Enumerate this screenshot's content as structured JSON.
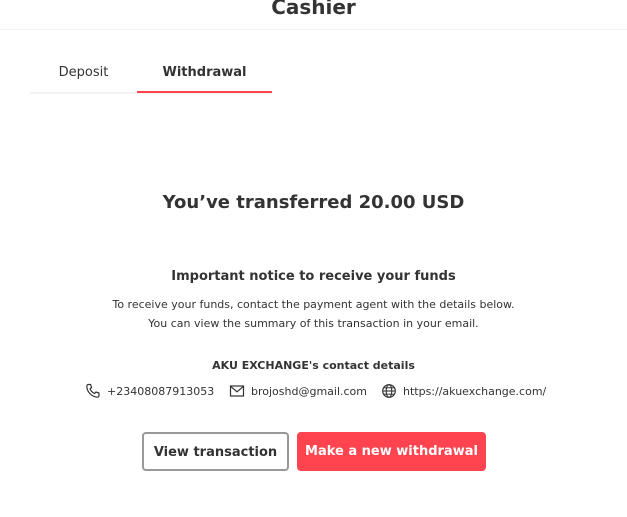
{
  "header": {
    "title": "Cashier"
  },
  "tabs": [
    {
      "label": "Deposit",
      "active": false
    },
    {
      "label": "Withdrawal",
      "active": true
    }
  ],
  "main": {
    "headline": "You’ve transferred 20.00 USD",
    "notice_title": "Important notice to receive your funds",
    "notice_lines": [
      "To receive your funds, contact the payment agent with the details below.",
      "You can view the summary of this transaction in your email."
    ],
    "contact": {
      "title": "AKU EXCHANGE's contact details",
      "phone": "+23408087913053",
      "email": "brojoshd@gmail.com",
      "website": "https://akuexchange.com/",
      "icons": {
        "phone": "phone-icon",
        "email": "envelope-icon",
        "website": "globe-icon"
      }
    },
    "buttons": {
      "view_transaction": "View transaction",
      "new_withdrawal": "Make a new withdrawal"
    }
  },
  "colors": {
    "accent": "#ff444f",
    "text": "#333333",
    "secondary_border": "#999999",
    "divider": "#f2f2f2"
  }
}
